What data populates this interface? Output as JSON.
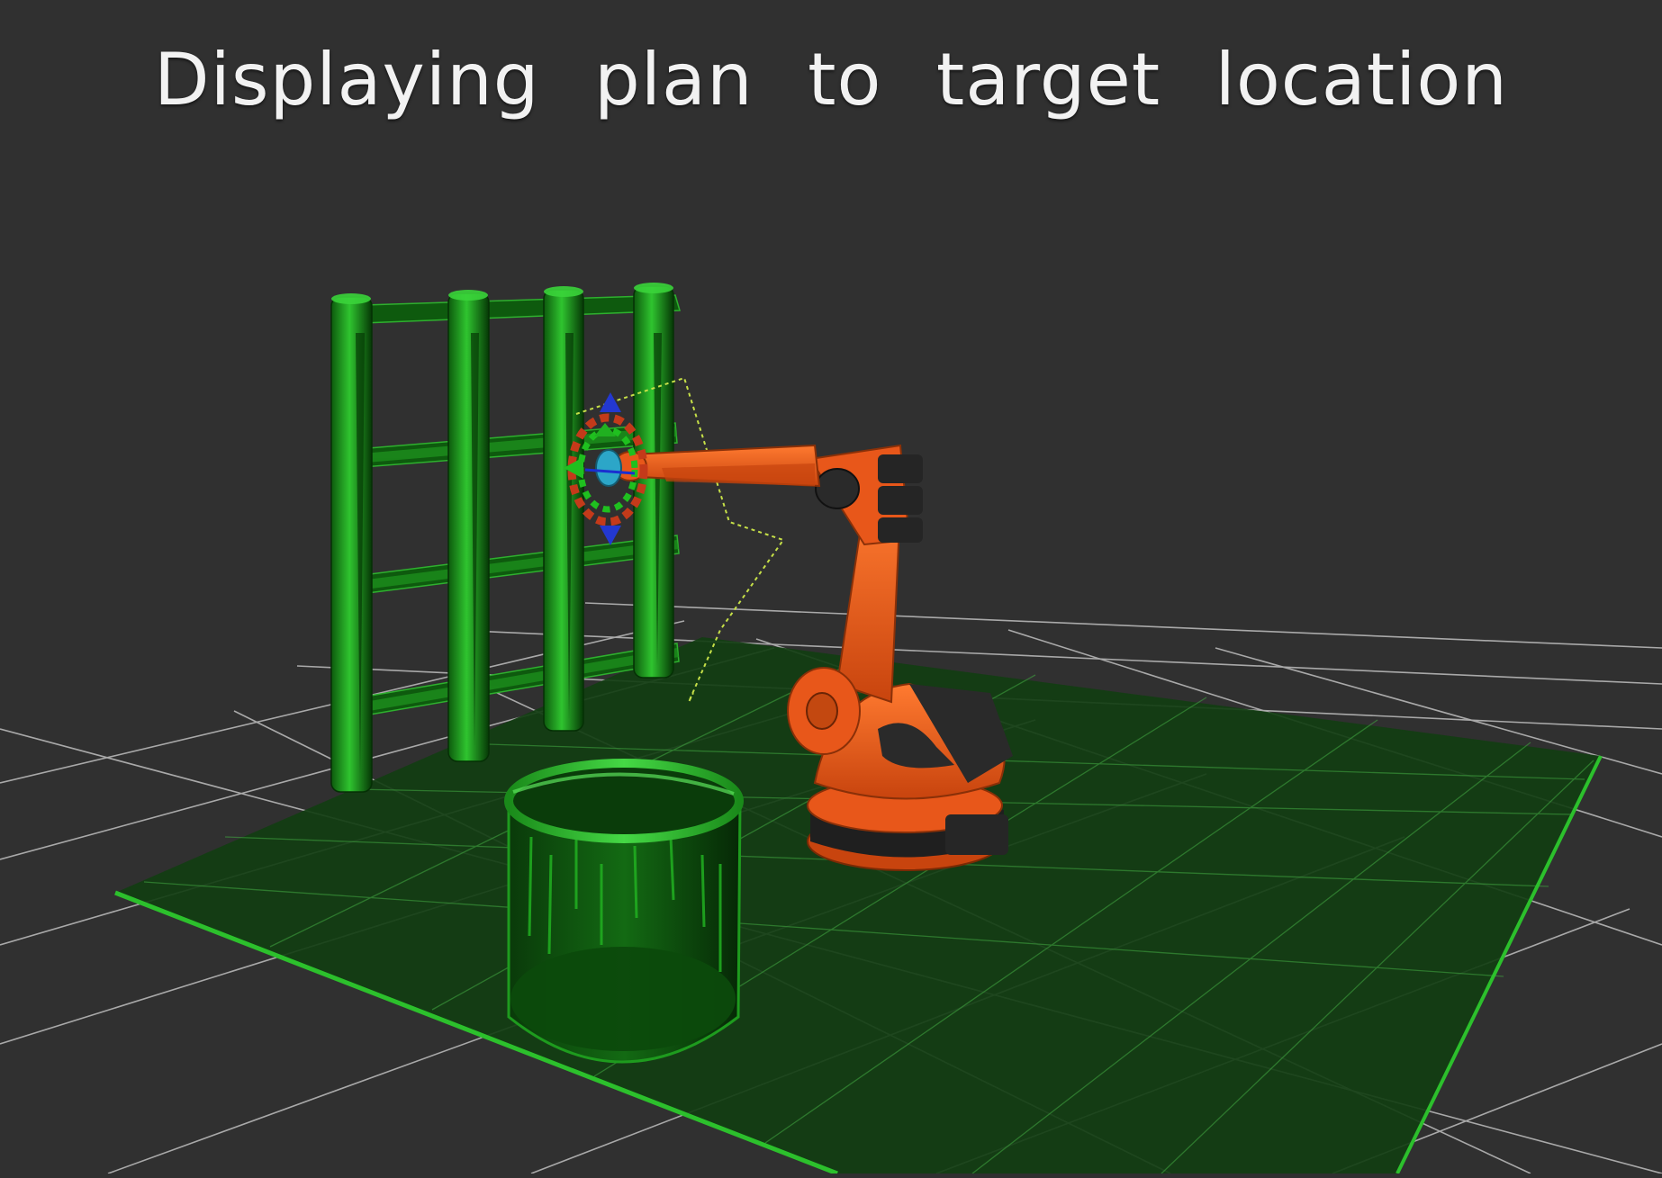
{
  "viewport": {
    "status_text": "Displaying plan to target location"
  },
  "colors": {
    "background": "#303030",
    "grid_line": "#a9a9a9",
    "scene_object_green": "#1fa01f",
    "floor_green": "#123e12",
    "robot_orange": "#e8571a",
    "robot_dark": "#2a2a2a",
    "trajectory": "#c6e048"
  },
  "scene": {
    "objects": [
      {
        "name": "shelf",
        "icon": "shelf-icon"
      },
      {
        "name": "bin",
        "icon": "cylinder-icon"
      },
      {
        "name": "floor-plane",
        "icon": "plane-icon"
      },
      {
        "name": "robot-arm",
        "icon": "robot-arm-icon"
      },
      {
        "name": "interactive-marker",
        "icon": "pose-marker-icon"
      }
    ]
  }
}
